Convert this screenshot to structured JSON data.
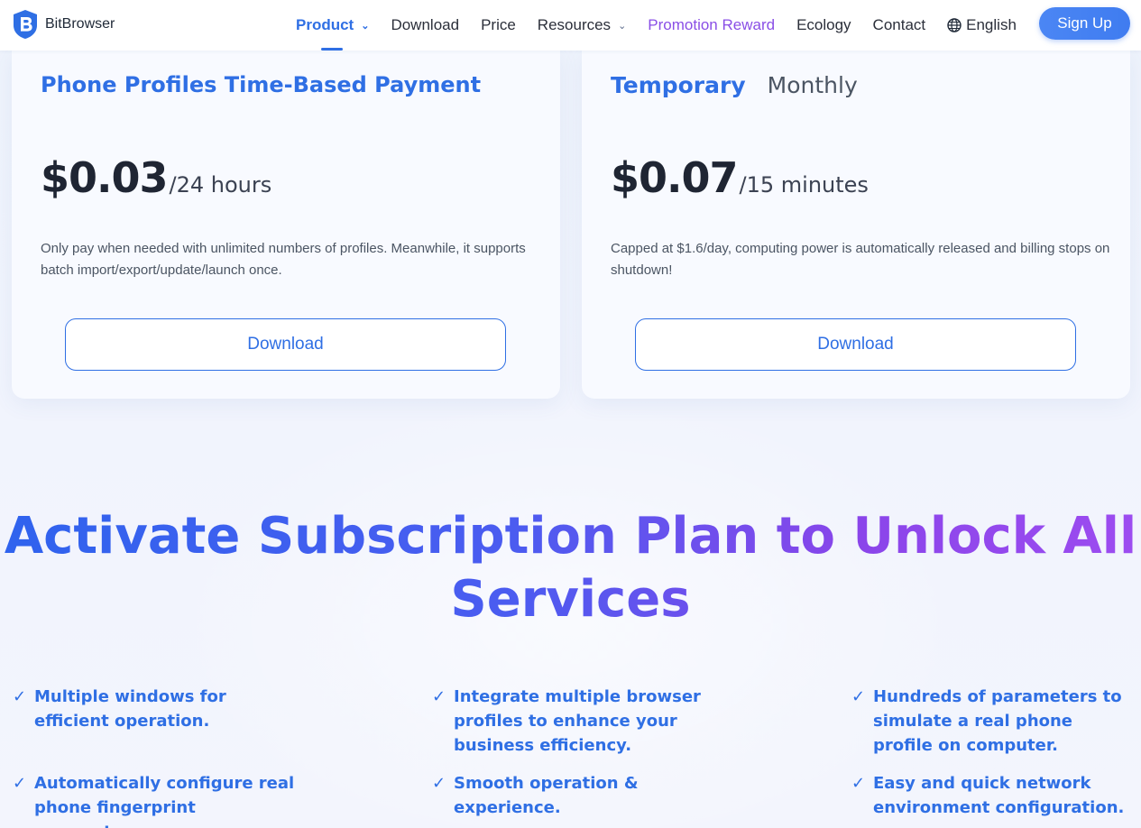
{
  "nav": {
    "brand": "BitBrowser",
    "items": [
      {
        "label": "Product",
        "has_dropdown": true,
        "active": true
      },
      {
        "label": "Download",
        "has_dropdown": false
      },
      {
        "label": "Price",
        "has_dropdown": false
      },
      {
        "label": "Resources",
        "has_dropdown": true
      },
      {
        "label": "Promotion Reward",
        "has_dropdown": false
      },
      {
        "label": "Ecology",
        "has_dropdown": false
      },
      {
        "label": "Contact",
        "has_dropdown": false
      },
      {
        "label": "English",
        "icon": "globe-icon"
      }
    ],
    "signup": "Sign Up"
  },
  "cards": [
    {
      "title": "Phone Profiles Time-Based Payment",
      "price": "$0.03",
      "unit": "/24 hours",
      "description": "Only pay when needed with unlimited numbers of profiles. Meanwhile, it supports batch import/export/update/launch once.",
      "button": "Download"
    },
    {
      "tabs": [
        "Temporary",
        "Monthly"
      ],
      "active_tab": "Temporary",
      "price": "$0.07",
      "unit": "/15 minutes",
      "description": "Capped at $1.6/day, computing power is automatically released and billing stops on shutdown!",
      "button": "Download"
    }
  ],
  "headline": {
    "line1": "Activate Subscription Plan to Unlock All",
    "line2": "Services"
  },
  "features": [
    "Multiple windows for efficient operation.",
    "Integrate multiple browser profiles to enhance your business efficiency.",
    "Hundreds of parameters to simulate a real phone profile on computer.",
    "Automatically configure real phone fingerprint parameters.",
    "Smooth operation & experience.",
    "Easy and quick network environment configuration."
  ],
  "colors": {
    "primary": "#2f6fe4",
    "promo": "#8a4fe6",
    "headline_start": "#2f63ee",
    "headline_end": "#9d4cf0"
  }
}
